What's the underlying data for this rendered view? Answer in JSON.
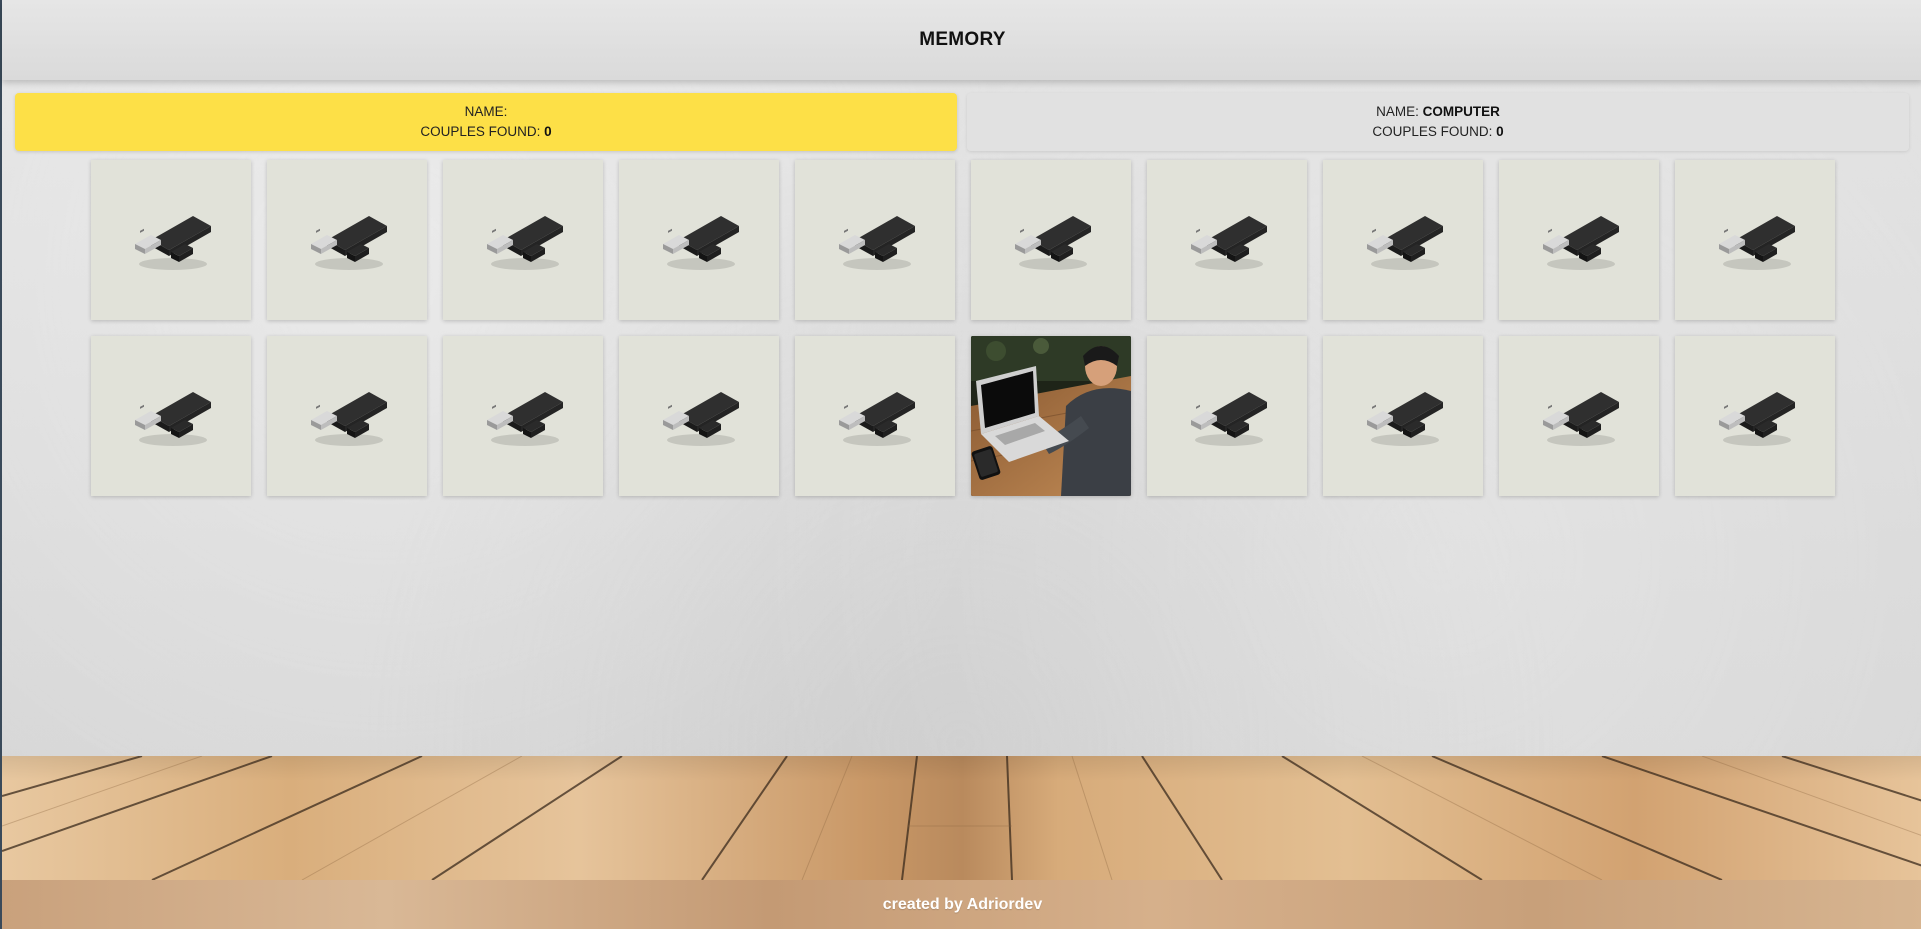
{
  "header": {
    "title": "MEMORY"
  },
  "players": [
    {
      "name_label": "NAME:",
      "name_value": "",
      "score_label": "COUPLES FOUND:",
      "score_value": "0",
      "active": true
    },
    {
      "name_label": "NAME:",
      "name_value": "COMPUTER",
      "score_label": "COUPLES FOUND:",
      "score_value": "0",
      "active": false
    }
  ],
  "board": {
    "rows": 2,
    "columns": 10,
    "card_back_icon": "usb-drive-icon",
    "cards": [
      {
        "state": "hidden"
      },
      {
        "state": "hidden"
      },
      {
        "state": "hidden"
      },
      {
        "state": "hidden"
      },
      {
        "state": "hidden"
      },
      {
        "state": "hidden"
      },
      {
        "state": "hidden"
      },
      {
        "state": "hidden"
      },
      {
        "state": "hidden"
      },
      {
        "state": "hidden"
      },
      {
        "state": "hidden"
      },
      {
        "state": "hidden"
      },
      {
        "state": "hidden"
      },
      {
        "state": "hidden"
      },
      {
        "state": "hidden"
      },
      {
        "state": "revealed",
        "image": "person-laptop-photo"
      },
      {
        "state": "hidden"
      },
      {
        "state": "hidden"
      },
      {
        "state": "hidden"
      },
      {
        "state": "hidden"
      }
    ]
  },
  "footer": {
    "credit": "created by Adriordev"
  },
  "colors": {
    "active_player": "#fde047",
    "card_back": "#e1e2d9"
  }
}
